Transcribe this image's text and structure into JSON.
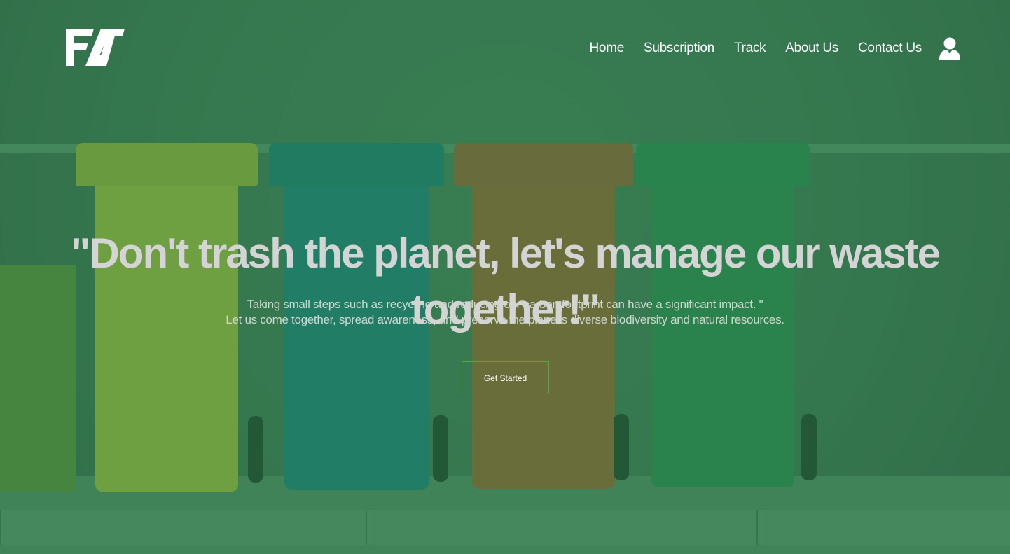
{
  "brand": {
    "logo_text": "FAT"
  },
  "nav": {
    "items": [
      {
        "label": "Home"
      },
      {
        "label": "Subscription"
      },
      {
        "label": "Track"
      },
      {
        "label": "About Us"
      },
      {
        "label": "Contact Us"
      }
    ],
    "account_icon": "user-icon"
  },
  "hero": {
    "headline": "\"Don't trash the planet, let's manage our waste together!\"",
    "subtext_line1": "Taking small steps such as recycling and reducing our carbon footprint can have a significant impact. \"",
    "subtext_line2": "Let us come together, spread awareness, and preserve the planet's diverse biodiversity and natural resources.",
    "cta_label": "Get Started"
  },
  "colors": {
    "overlay": "#3a7a50",
    "text_primary": "#ffffff",
    "headline": "#d4d4d4",
    "cta_border": "#55a84a"
  }
}
